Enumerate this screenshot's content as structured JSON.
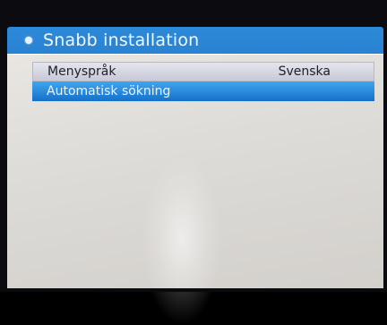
{
  "header": {
    "title": "Snabb installation"
  },
  "menu": {
    "items": [
      {
        "label": "Menyspråk",
        "value": "Svenska"
      },
      {
        "label": "Automatisk sökning",
        "value": ""
      }
    ],
    "selected_index": 1
  },
  "colors": {
    "frame_blue": "#1b74c2",
    "highlight_blue": "#1670c8",
    "panel_bg": "#dedcd8",
    "row_text": "#1f1f2a"
  },
  "icons": {
    "title_bullet": "bullet-dot-icon"
  }
}
